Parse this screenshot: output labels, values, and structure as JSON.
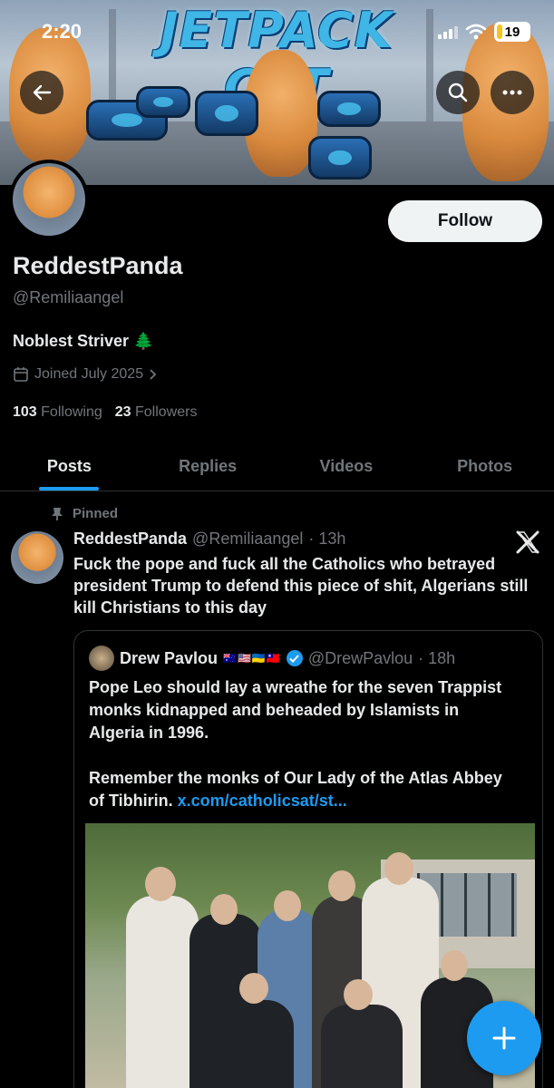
{
  "status_bar": {
    "time": "2:20",
    "battery": "19"
  },
  "banner": {
    "title": "JETPACK CAT"
  },
  "profile": {
    "follow_label": "Follow",
    "display_name": "ReddestPanda",
    "handle": "@Remiliaangel",
    "bio": "Noblest Striver 🌲",
    "joined": "Joined July 2025",
    "following_count": "103",
    "following_label": "Following",
    "followers_count": "23",
    "followers_label": "Followers"
  },
  "tabs": [
    {
      "label": "Posts",
      "active": true
    },
    {
      "label": "Replies",
      "active": false
    },
    {
      "label": "Videos",
      "active": false
    },
    {
      "label": "Photos",
      "active": false
    }
  ],
  "post": {
    "pinned_label": "Pinned",
    "author_name": "ReddestPanda",
    "author_handle": "@Remiliaangel",
    "time": "· 13h",
    "text": "Fuck the pope and fuck all the Catholics who betrayed president Trump to defend this piece of shit, Algerians still kill Christians to this day",
    "quote": {
      "author_name": "Drew Pavlou",
      "flags": "🇦🇺🇺🇸🇺🇦🇹🇼",
      "author_handle": "@DrewPavlou",
      "time": "· 18h",
      "text": "Pope Leo should lay a wreathe for the seven Trappist monks kidnapped and beheaded by Islamists in Algeria in 1996.\n\nRemember the monks of Our Lady of the Atlas Abbey of Tibhirin. ",
      "link": "x.com/catholicsat/st..."
    }
  },
  "colors": {
    "accent": "#1d9bf0",
    "background": "#000000",
    "muted": "#71767b",
    "text": "#e7e9ea"
  },
  "icons": [
    "back-arrow-icon",
    "search-icon",
    "more-icon",
    "calendar-icon",
    "chevron-right-icon",
    "pin-icon",
    "x-logo-icon",
    "verified-icon",
    "plus-icon"
  ]
}
